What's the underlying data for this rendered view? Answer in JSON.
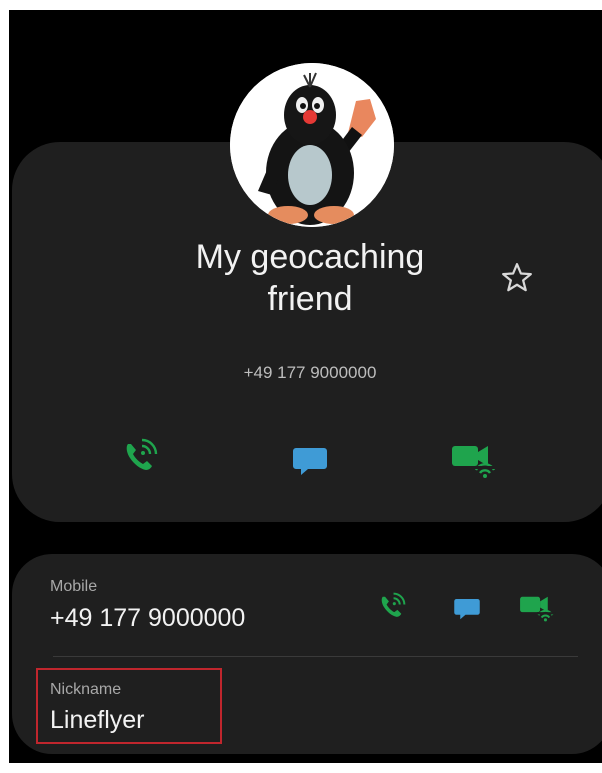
{
  "contact": {
    "name": "My geocaching friend",
    "phone_display": "+49 177 9000000"
  },
  "details": {
    "mobile_label": "Mobile",
    "mobile_value": "+49 177 9000000",
    "nickname_label": "Nickname",
    "nickname_value": "Lineflyer"
  },
  "icons": {
    "favorite": "star-outline-icon",
    "call": "wifi-call-icon",
    "message": "message-bubble-icon",
    "video": "wifi-video-call-icon"
  },
  "colors": {
    "accent_green": "#1fa44d",
    "accent_blue": "#3f9bd6",
    "highlight_red": "#c0262d"
  }
}
